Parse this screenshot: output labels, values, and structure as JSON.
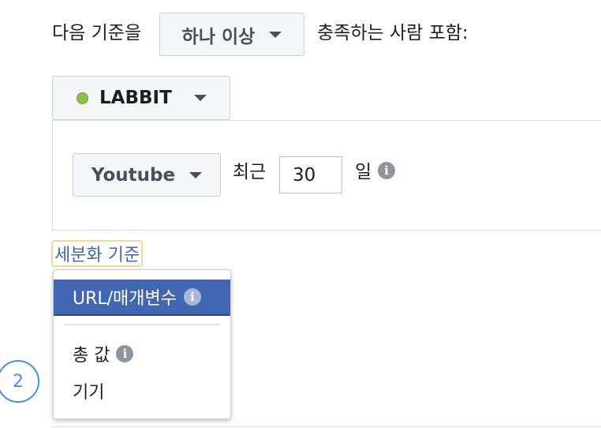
{
  "criteria": {
    "prefix": "다음 기준을",
    "match_select": "하나 이상",
    "suffix": "충족하는 사람 포함:"
  },
  "pixel": {
    "name": "LABBIT",
    "status_color": "#8bc34a"
  },
  "rule": {
    "source": "Youtube",
    "recent_label": "최근",
    "days_value": "30",
    "days_unit": "일"
  },
  "refine_link": "세분화 기준",
  "dropdown": {
    "items": [
      {
        "label": "URL/매개변수",
        "selected": true,
        "info": true
      },
      {
        "label": "총 값",
        "selected": false,
        "info": true
      },
      {
        "label": "기기",
        "selected": false,
        "info": false
      }
    ]
  },
  "step_badge": "2",
  "icons": {
    "info": "i"
  },
  "colors": {
    "link": "#4267b2",
    "selected": "#4267b2",
    "step": "#4a90e2"
  }
}
